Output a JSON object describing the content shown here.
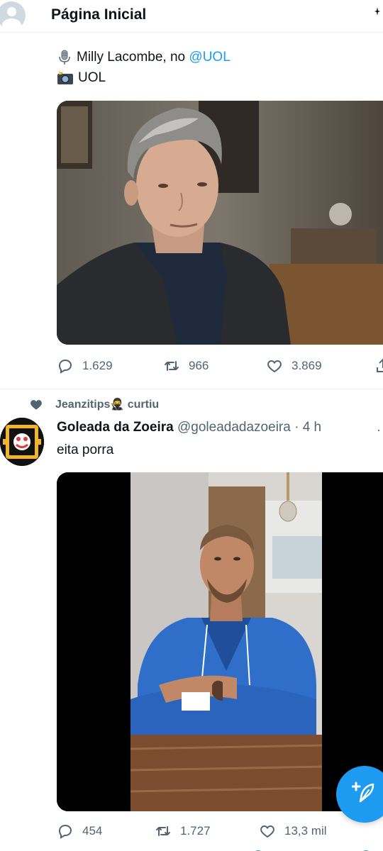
{
  "header": {
    "title": "Página Inicial"
  },
  "tweet1": {
    "line1_prefix": "Milly Lacombe, no ",
    "line1_mention": "@UOL",
    "line2_text": "UOL",
    "icons": [
      "microphone-icon",
      "camera-flash-icon"
    ],
    "actions": {
      "replies": "1.629",
      "retweets": "966",
      "likes": "3.869"
    }
  },
  "tweet2": {
    "social_context": "Jeanzitips🥷 curtiu",
    "author_name": "Goleada da Zoeira",
    "author_handle": "@goleadadazoeira",
    "separator": "·",
    "time": "4 h",
    "text": "eita porra",
    "actions": {
      "replies": "454",
      "retweets": "1.727",
      "likes": "13,3 mil"
    }
  },
  "colors": {
    "accent": "#1d9bf0",
    "muted": "#536471",
    "text": "#0f1419"
  }
}
